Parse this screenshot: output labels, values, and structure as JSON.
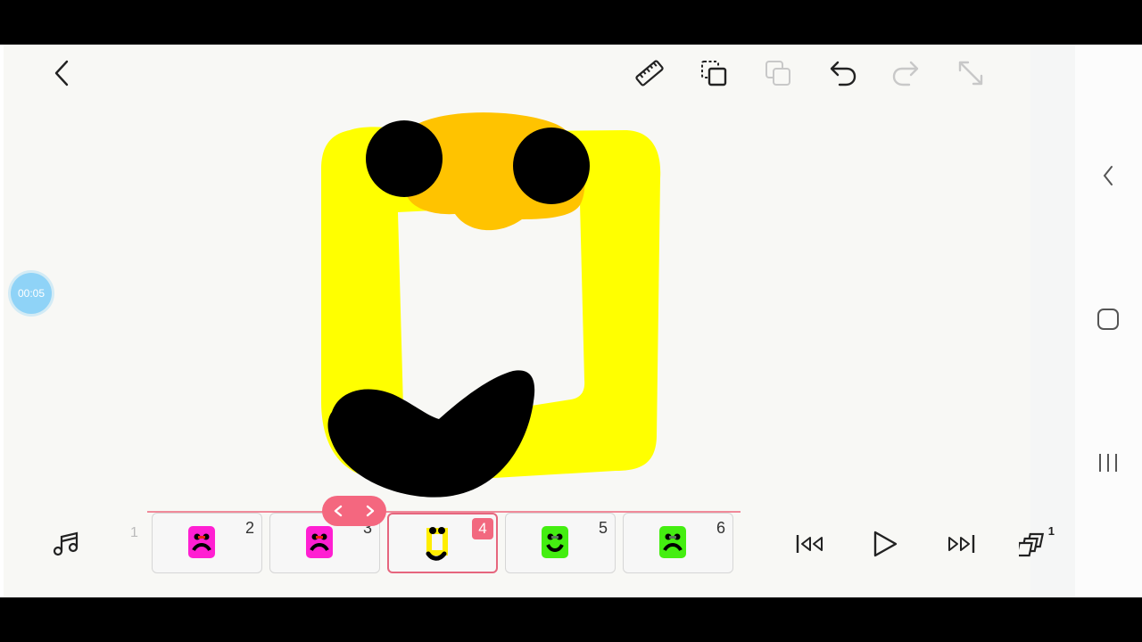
{
  "app": {
    "timestamp": "00:05"
  },
  "toolbar": {
    "back_icon": "chevron-left-icon",
    "ruler_icon": "ruler-icon",
    "copy_icon": "copy-frame-icon",
    "paste_icon": "paste-frame-icon",
    "undo_icon": "undo-icon",
    "redo_icon": "redo-icon",
    "expand_icon": "expand-icon",
    "more_icon": "more-vertical-icon"
  },
  "timeline": {
    "frames": [
      {
        "number": "1"
      },
      {
        "number": "2",
        "color": "#ff1fd2",
        "face": "sad"
      },
      {
        "number": "3",
        "color": "#ff1fd2",
        "face": "sad"
      },
      {
        "number": "4",
        "color": "#ffee00",
        "face": "happy",
        "active": true
      },
      {
        "number": "5",
        "color": "#44ee11",
        "face": "happy"
      },
      {
        "number": "6",
        "color": "#44ee11",
        "face": "sad"
      }
    ]
  },
  "playback": {
    "music_icon": "music-note-icon",
    "first_icon": "skip-to-start-icon",
    "play_icon": "play-icon",
    "last_icon": "skip-to-end-icon",
    "layers_icon": "layers-icon",
    "layers_count": "1"
  },
  "colors": {
    "body": "#ffff00",
    "nose": "#ffc300",
    "features": "#000000",
    "accent": "#f2687f",
    "time_badge": "#8fd3f7"
  }
}
